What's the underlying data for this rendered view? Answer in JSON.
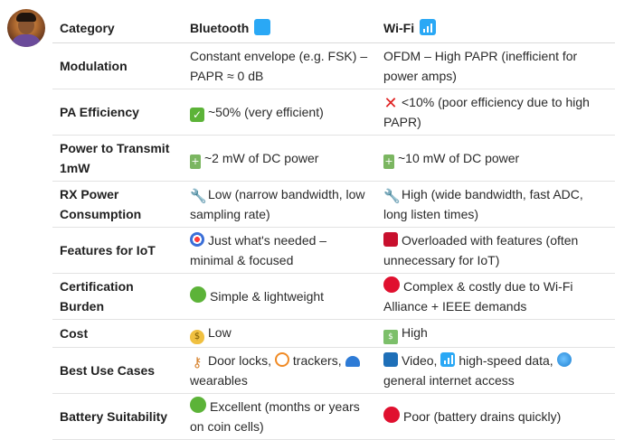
{
  "table": {
    "headers": {
      "category": "Category",
      "bluetooth": "Bluetooth",
      "wifi": "Wi-Fi"
    },
    "rows": [
      {
        "category": "Modulation",
        "bluetooth": "Constant envelope (e.g. FSK) – PAPR ≈ 0 dB",
        "wifi": "OFDM – High PAPR (inefficient for power amps)"
      },
      {
        "category": "PA Efficiency",
        "bluetooth": "~50% (very efficient)",
        "wifi": "<10% (poor efficiency due to high PAPR)"
      },
      {
        "category": "Power to Transmit 1mW",
        "bluetooth": "~2 mW of DC power",
        "wifi": "~10 mW of DC power"
      },
      {
        "category": "RX Power Consumption",
        "bluetooth": "Low (narrow bandwidth, low sampling rate)",
        "wifi": "High (wide bandwidth, fast ADC, long listen times)"
      },
      {
        "category": "Features for IoT",
        "bluetooth": "Just what's needed – minimal & focused",
        "wifi": "Overloaded with features (often unnecessary for IoT)"
      },
      {
        "category": "Certification Burden",
        "bluetooth": "Simple & lightweight",
        "wifi": "Complex & costly due to Wi-Fi Alliance + IEEE demands"
      },
      {
        "category": "Cost",
        "bluetooth": "Low",
        "wifi": "High"
      },
      {
        "category": "Best Use Cases",
        "bluetooth_parts": [
          "Door locks,",
          "trackers,",
          "wearables"
        ],
        "wifi_parts": [
          "Video,",
          "high-speed data,",
          "general internet access"
        ]
      },
      {
        "category": "Battery Suitability",
        "bluetooth": "Excellent (months or years on coin cells)",
        "wifi": "Poor (battery drains quickly)"
      }
    ]
  },
  "icons": {
    "bluetooth_header": "blue-square-icon",
    "wifi_header": "signal-bars-icon",
    "pa_bt": "check-mark-icon",
    "pa_wifi": "cross-mark-icon",
    "power": "battery-icon",
    "rx": "wrench-icon",
    "features_bt": "bullseye-icon",
    "features_wifi": "gift-icon",
    "cert_bt": "green-circle-icon",
    "cert_wifi": "red-circle-icon",
    "cost_bt": "money-bag-icon",
    "cost_wifi": "banknotes-icon",
    "use_bt": [
      "key-icon",
      "compass-icon",
      "cap-icon"
    ],
    "use_wifi": [
      "tv-icon",
      "signal-bars-icon",
      "globe-icon"
    ]
  },
  "colors": {
    "accent_blue": "#2aa8f5",
    "good_green": "#5cb338",
    "bad_red": "#e0102f"
  }
}
